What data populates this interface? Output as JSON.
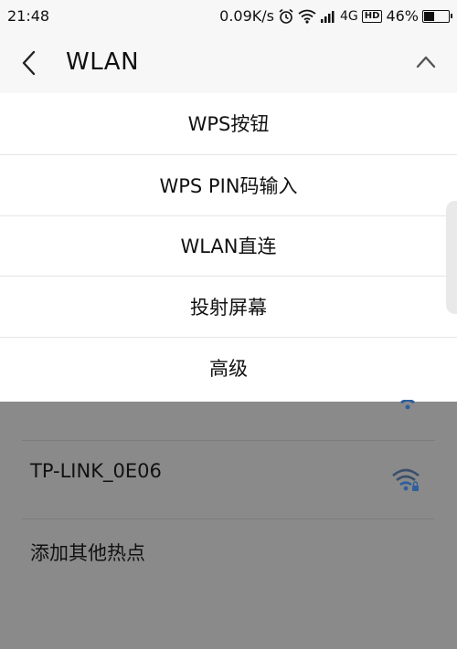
{
  "status_bar": {
    "time": "21:48",
    "speed": "0.09K/s",
    "network": "4G",
    "hd": "HD",
    "battery": "46%",
    "battery_level": 0.46
  },
  "header": {
    "title": "WLAN"
  },
  "menu": {
    "items": [
      {
        "label": "WPS按钮"
      },
      {
        "label": "WPS PIN码输入"
      },
      {
        "label": "WLAN直连"
      },
      {
        "label": "投射屏幕"
      },
      {
        "label": "高级"
      }
    ]
  },
  "list": {
    "network": "TP-LINK_0E06",
    "add_hotspot": "添加其他热点"
  },
  "colors": {
    "accent": "#2f5f9c",
    "overlay": "#8a8a8a",
    "menu_bg": "#ffffff"
  },
  "icons": {
    "back": "back-icon",
    "collapse": "chevron-up-icon",
    "alarm": "alarm-icon",
    "wifi_status": "wifi-icon",
    "signal": "signal-icon",
    "battery": "battery-icon",
    "network_strength": "wifi-lock-icon"
  }
}
